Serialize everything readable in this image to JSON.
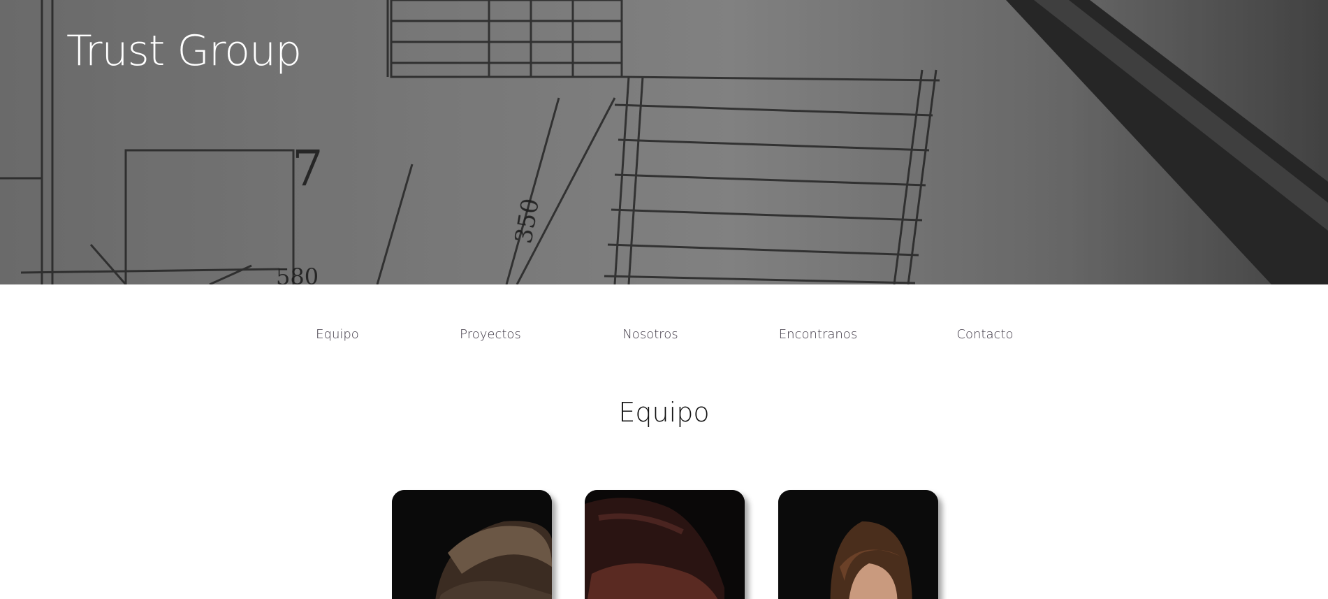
{
  "header": {
    "brand": "Trust Group",
    "background_icon": "blueprint-plan-image"
  },
  "nav": {
    "items": [
      {
        "label": "Equipo"
      },
      {
        "label": "Proyectos"
      },
      {
        "label": "Nosotros"
      },
      {
        "label": "Encontranos"
      },
      {
        "label": "Contacto"
      }
    ]
  },
  "team_section": {
    "title": "Equipo",
    "members": [
      {
        "photo": "team-member-photo-1"
      },
      {
        "photo": "team-member-photo-2"
      },
      {
        "photo": "team-member-photo-3"
      }
    ]
  },
  "colors": {
    "nav_text": "#3a3340",
    "hero_overlay": "#7a7a7a",
    "brand_text": "#ffffff"
  }
}
